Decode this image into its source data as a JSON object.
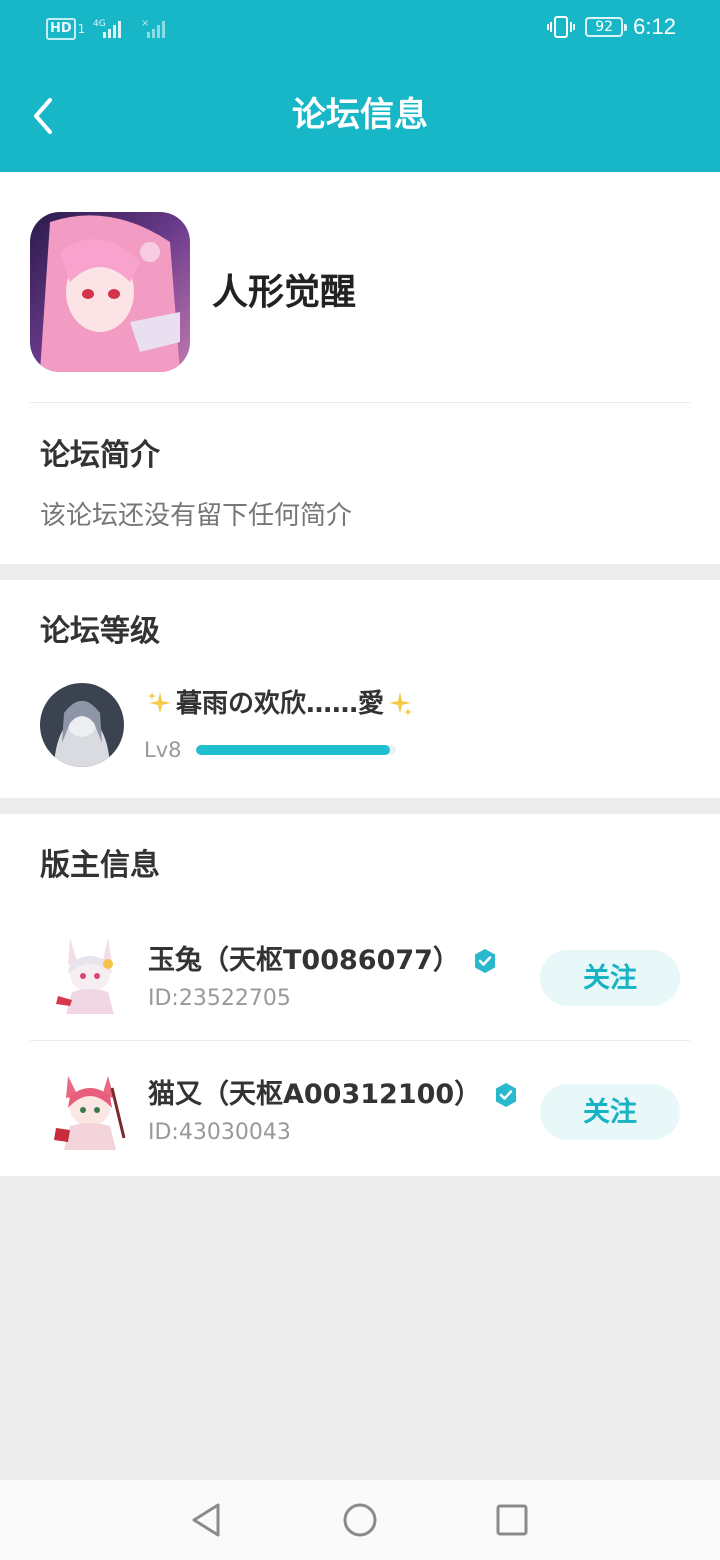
{
  "status_bar": {
    "network_badge": "HD",
    "sim_index": "1",
    "network_type": "4G",
    "battery": "92",
    "time": "6:12"
  },
  "header": {
    "title": "论坛信息",
    "back_icon": "chevron-left-icon"
  },
  "forum": {
    "name": "人形觉醒",
    "intro_title": "论坛简介",
    "intro_text": "该论坛还没有留下任何简介"
  },
  "level": {
    "section_title": "论坛等级",
    "user_name": "暮雨の欢欣……愛",
    "level_label": "Lv8",
    "progress_fraction": 0.97
  },
  "moderators": {
    "section_title": "版主信息",
    "items": [
      {
        "name": "玉兔（天枢T0086077）",
        "id": "ID:23522705",
        "follow_label": "关注"
      },
      {
        "name": "猫又（天枢A00312100）",
        "id": "ID:43030043",
        "follow_label": "关注"
      }
    ]
  },
  "colors": {
    "accent": "#17b7c8",
    "follow_bg": "#e8f7f8",
    "page_bg": "#ececec"
  },
  "nav_icons": [
    "back-triangle-icon",
    "home-circle-icon",
    "recents-square-icon"
  ]
}
